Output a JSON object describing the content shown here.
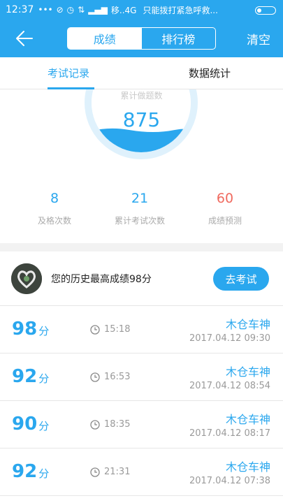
{
  "status_bar": {
    "time": "12:37",
    "icons": [
      "more-dots",
      "no-data",
      "alarm-clock",
      "signal",
      "signal-bars"
    ],
    "carrier": "移..4G",
    "notice": "只能拨打紧急呼救..."
  },
  "nav": {
    "back_icon": "arrow-left-icon",
    "segments": [
      "成绩",
      "排行榜"
    ],
    "active_segment": 0,
    "action": "清空"
  },
  "tabs": [
    "考试记录",
    "数据统计"
  ],
  "gauge": {
    "label": "累计做题数",
    "value": "875",
    "fill_level": 0.25
  },
  "stats": [
    {
      "value": "8",
      "label": "及格次数"
    },
    {
      "value": "21",
      "label": "累计考试次数"
    },
    {
      "value": "60",
      "label": "成绩预测"
    }
  ],
  "best": {
    "text": "您的历史最高成绩98分",
    "button": "去考试"
  },
  "records": [
    {
      "score": "98",
      "unit": "分",
      "duration": "15:18",
      "name": "木仓车神",
      "date": "2017.04.12  09:30"
    },
    {
      "score": "92",
      "unit": "分",
      "duration": "16:53",
      "name": "木仓车神",
      "date": "2017.04.12  08:54"
    },
    {
      "score": "90",
      "unit": "分",
      "duration": "18:35",
      "name": "木仓车神",
      "date": "2017.04.12  08:17"
    },
    {
      "score": "92",
      "unit": "分",
      "duration": "21:31",
      "name": "木仓车神",
      "date": "2017.04.12  07:38"
    }
  ],
  "colors": {
    "primary": "#2aa7ee",
    "prediction": "#f06a5f",
    "muted": "#9a9a9a"
  }
}
